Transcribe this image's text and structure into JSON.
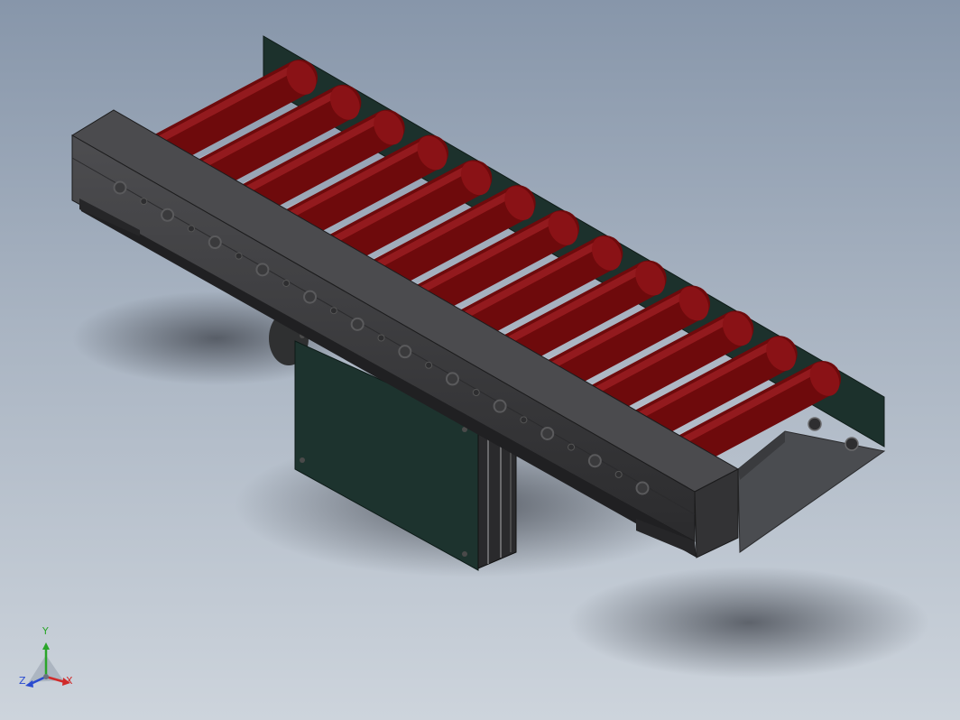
{
  "viewport": {
    "background_top": "#8796aa",
    "background_bottom": "#cdd4dc"
  },
  "model": {
    "roller_count": 13,
    "colors": {
      "roller": "#6e0a0c",
      "roller_highlight": "#a42226",
      "frame": "#3a3a3c",
      "frame_top": "#4b4b4e",
      "plate": "#1c312c",
      "bolt": "#5a5a5c"
    }
  },
  "triad": {
    "y_label": "Y",
    "z_label": "Z",
    "x_label": "X",
    "y_color": "#2aa52a",
    "z_color": "#2a4bd0",
    "x_color": "#d02a2a"
  }
}
